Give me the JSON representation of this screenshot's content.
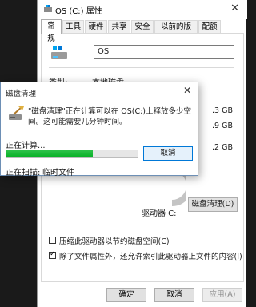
{
  "props_window": {
    "title": "OS (C:) 属性",
    "close": "✕",
    "tabs": [
      "常规",
      "工具",
      "硬件",
      "共享",
      "安全",
      "以前的版本",
      "配额"
    ],
    "name_value": "OS",
    "type_label": "类型:",
    "type_value": "本地磁盘",
    "size_rows": [
      ".3 GB",
      ".9 GB",
      ".2 GB"
    ],
    "drive_label": "驱动器 C:",
    "cleanup_button": "磁盘清理(D)",
    "compress_label": "压缩此驱动器以节约磁盘空间(C)",
    "compress_checked": false,
    "index_label": "除了文件属性外，还允许索引此驱动器上文件的内容(I)",
    "index_checked": true,
    "ok_button": "确定",
    "cancel_button": "取消",
    "apply_button": "应用(A)"
  },
  "cleanup_dialog": {
    "title": "磁盘清理",
    "close": "✕",
    "message": "\"磁盘清理\"正在计算可以在 OS(C:)上释放多少空间。这可能需要几分钟时间。",
    "calculating_label": "正在计算...",
    "progress_fraction": 0.66,
    "cancel_button": "取消",
    "scanning_label": "正在扫描:",
    "scanning_value": "临时文件"
  },
  "colors": {
    "progress": "#06b025",
    "focus_border": "#0078d7",
    "chart_gray": "#c4c4c4"
  }
}
